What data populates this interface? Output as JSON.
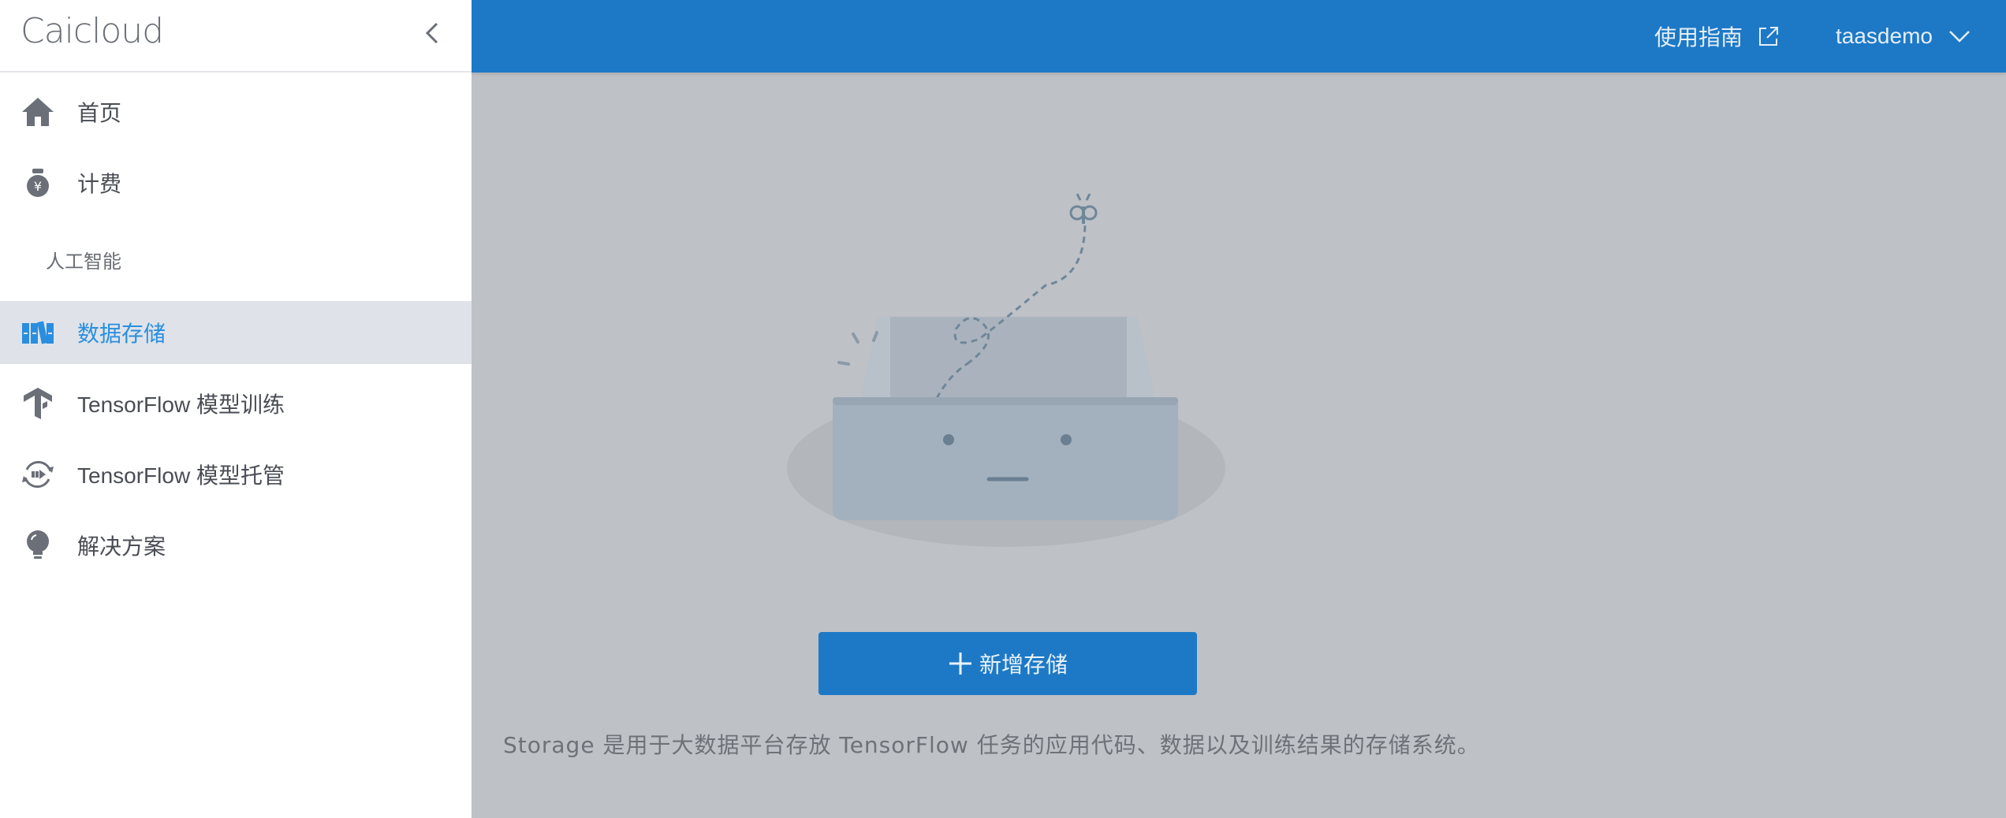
{
  "sidebar": {
    "logo": "Caicloud",
    "items": [
      {
        "label": "首页",
        "icon": "home-icon"
      },
      {
        "label": "计费",
        "icon": "money-bag-icon"
      },
      {
        "label": "数据存储",
        "icon": "storage-icon"
      },
      {
        "label": "TensorFlow 模型训练",
        "icon": "tensorflow-icon"
      },
      {
        "label": "TensorFlow 模型托管",
        "icon": "model-hosting-icon"
      },
      {
        "label": "解决方案",
        "icon": "lightbulb-icon"
      }
    ],
    "section_label": "人工智能",
    "active_item": "数据存储"
  },
  "topbar": {
    "guide_label": "使用指南",
    "username": "taasdemo"
  },
  "main": {
    "add_button_label": "新增存储",
    "description": "Storage 是用于大数据平台存放 TensorFlow 任务的应用代码、数据以及训练结果的存储系统。"
  },
  "colors": {
    "primary": "#1d79c6",
    "active_text": "#2a8ee0",
    "overlay": "#bec1c6",
    "active_bg": "#dfe3e9"
  }
}
